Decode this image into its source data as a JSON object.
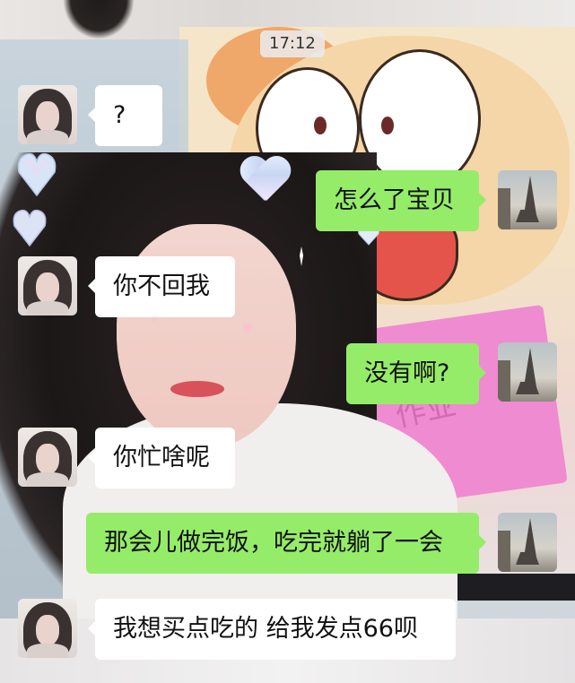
{
  "status": {
    "time": "17:12"
  },
  "messages": [
    {
      "side": "in",
      "text": "?"
    },
    {
      "side": "out",
      "text": "怎么了宝贝"
    },
    {
      "side": "in",
      "text": "你不回我"
    },
    {
      "side": "out",
      "text": "没有啊?"
    },
    {
      "side": "in",
      "text": "你忙啥呢"
    },
    {
      "side": "out",
      "text": "那会儿做完饭，吃完就躺了一会"
    },
    {
      "side": "in",
      "text": "我想买点吃的 给我发点66呗"
    }
  ],
  "background": {
    "book_text": "作业"
  },
  "colors": {
    "incoming_bubble": "#ffffff",
    "outgoing_bubble": "#95ec69",
    "text": "#111111"
  },
  "avatars": {
    "contact": "girl-avatar",
    "self": "eiffel-tower-avatar"
  }
}
